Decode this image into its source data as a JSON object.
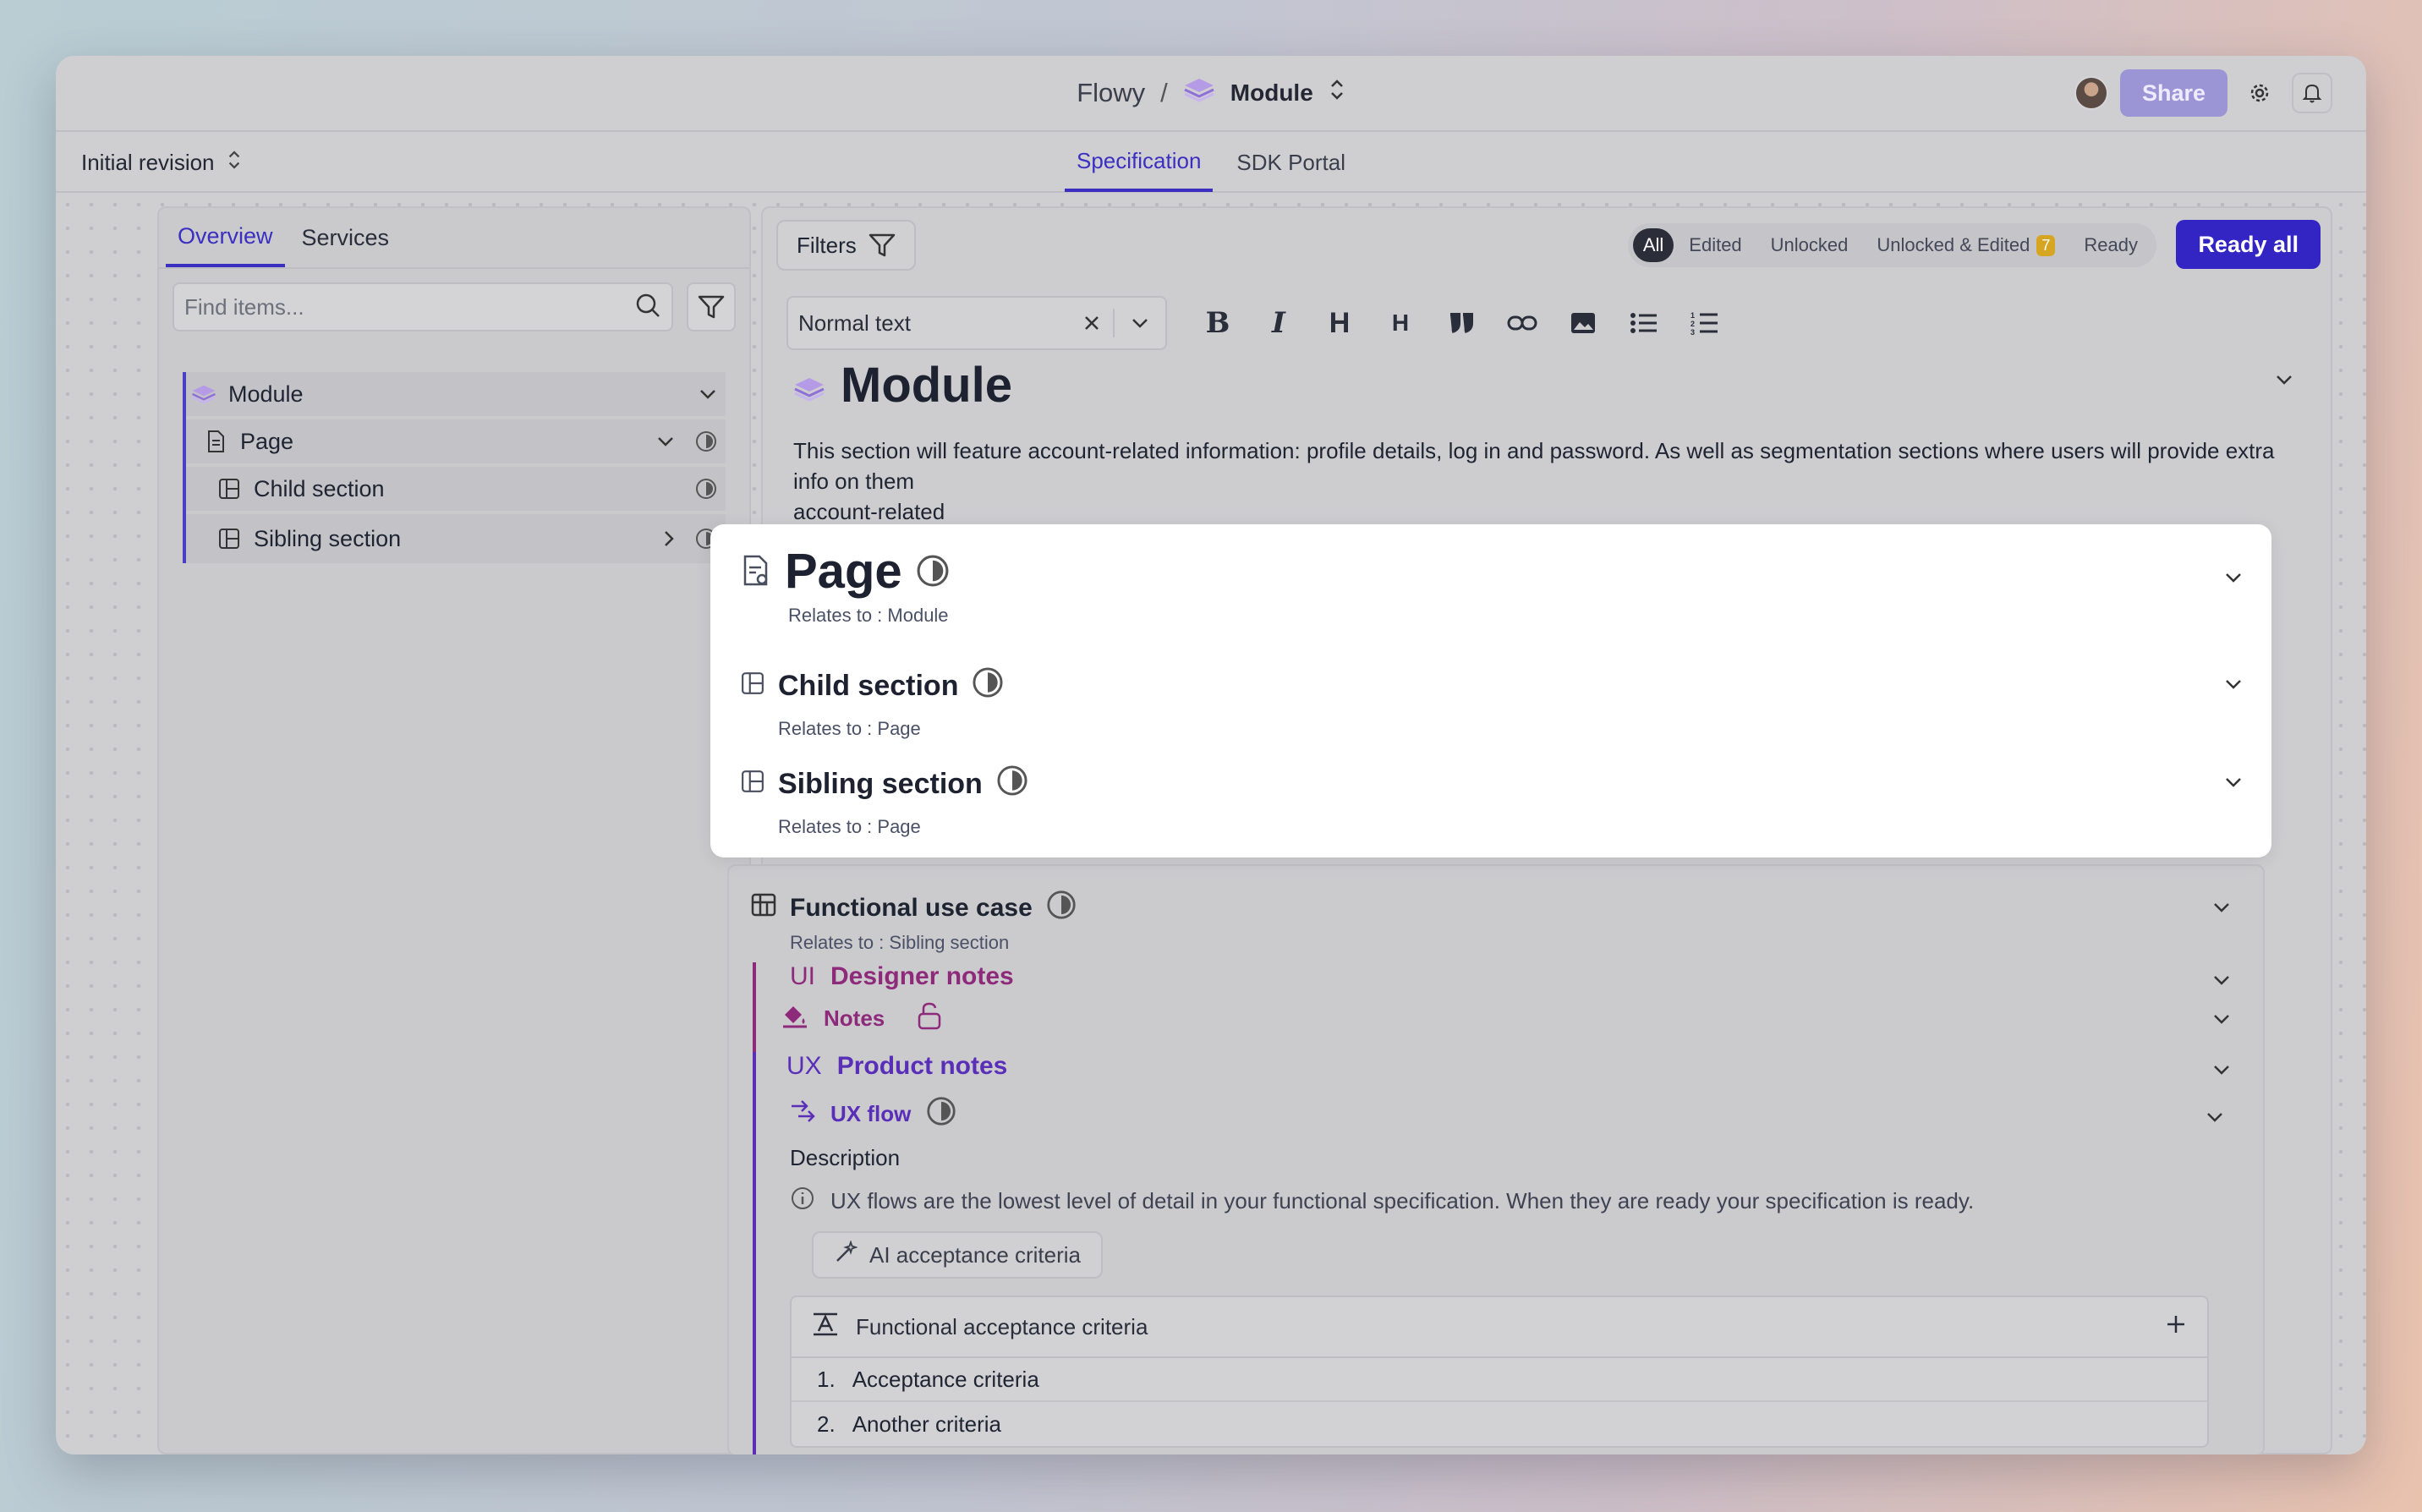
{
  "header": {
    "app_name": "Flowy",
    "separator": "/",
    "current_item": "Module",
    "share_label": "Share"
  },
  "subbar": {
    "revision": "Initial revision",
    "tabs": [
      {
        "label": "Specification",
        "active": true
      },
      {
        "label": "SDK Portal",
        "active": false
      }
    ]
  },
  "sidebar": {
    "tabs": [
      {
        "label": "Overview",
        "active": true
      },
      {
        "label": "Services",
        "active": false
      }
    ],
    "search_placeholder": "Find items...",
    "tree": [
      {
        "label": "Module",
        "icon": "module-icon"
      },
      {
        "label": "Page",
        "icon": "page-icon"
      },
      {
        "label": "Child section",
        "icon": "section-icon"
      },
      {
        "label": "Sibling section",
        "icon": "section-icon"
      }
    ]
  },
  "main": {
    "filters_label": "Filters",
    "status_filters": [
      {
        "label": "All",
        "active": true
      },
      {
        "label": "Edited"
      },
      {
        "label": "Unlocked"
      },
      {
        "label": "Unlocked & Edited",
        "badge": "7"
      },
      {
        "label": "Ready"
      }
    ],
    "ready_all_label": "Ready all",
    "text_style": "Normal text",
    "toolbar_icons": [
      "bold-icon",
      "italic-icon",
      "heading1-icon",
      "heading2-icon",
      "quote-icon",
      "link-icon",
      "image-icon",
      "bullet-list-icon",
      "numbered-list-icon"
    ],
    "module": {
      "title": "Module",
      "description": "This section will feature account-related information: profile details, log in and password. As well as segmentation sections where users will provide extra info on them",
      "tag": "account-related"
    },
    "cards": [
      {
        "title": "Page",
        "relates": "Relates to : Module"
      },
      {
        "title": "Child section",
        "relates": "Relates to : Page"
      },
      {
        "title": "Sibling section",
        "relates": "Relates to : Page"
      }
    ],
    "use_case": {
      "title": "Functional use case",
      "relates": "Relates to : Sibling section",
      "designer_prefix": "UI",
      "designer_title": "Designer notes",
      "notes_label": "Notes",
      "product_prefix": "UX",
      "product_title": "Product notes",
      "flow_label": "UX flow",
      "description_label": "Description",
      "info_text": "UX flows are the lowest level of detail in your functional specification. When they are ready your specification is ready.",
      "ai_button": "AI acceptance criteria",
      "criteria_title": "Functional acceptance criteria",
      "criteria": [
        {
          "num": "1.",
          "text": "Acceptance criteria"
        },
        {
          "num": "2.",
          "text": "Another criteria"
        }
      ]
    }
  },
  "colors": {
    "accent": "#3325c4",
    "designer": "#8e2a7a",
    "product": "#5a2fb8"
  }
}
